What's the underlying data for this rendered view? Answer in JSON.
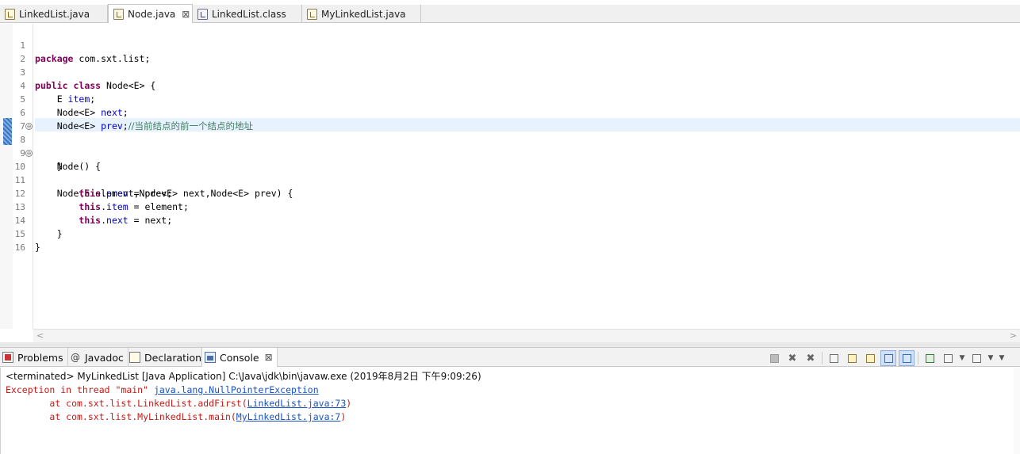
{
  "editor_tabs": [
    {
      "label": "LinkedList.java",
      "icon": "java-file-icon",
      "active": false
    },
    {
      "label": "Node.java",
      "icon": "java-file-icon",
      "active": true,
      "close": "⊠"
    },
    {
      "label": "LinkedList.class",
      "icon": "class-file-icon",
      "active": false
    },
    {
      "label": "MyLinkedList.java",
      "icon": "java-file-icon",
      "active": false
    }
  ],
  "code_lines": [
    {
      "n": "1",
      "text": "package com.sxt.list;"
    },
    {
      "n": "2",
      "text": ""
    },
    {
      "n": "3",
      "text": "public class Node<E> {"
    },
    {
      "n": "4",
      "text": "    E item;"
    },
    {
      "n": "5",
      "text": "    Node<E> next;"
    },
    {
      "n": "6",
      "text": "    Node<E> prev;//当前结点的前一个结点的地址"
    },
    {
      "n": "7",
      "text": ""
    },
    {
      "n": "8",
      "text": "    Node() {",
      "fold": "⊖",
      "current": true
    },
    {
      "n": "9",
      "text": "    }"
    },
    {
      "n": "10",
      "text": "    Node(E element,Node<E> next,Node<E> prev) {",
      "fold": "⊖"
    },
    {
      "n": "11",
      "text": "        this.prev = prev;"
    },
    {
      "n": "12",
      "text": "        this.item = element;"
    },
    {
      "n": "13",
      "text": "        this.next = next;"
    },
    {
      "n": "14",
      "text": "    }"
    },
    {
      "n": "15",
      "text": "}"
    },
    {
      "n": "16",
      "text": ""
    }
  ],
  "code_tokens": {
    "l1": {
      "kw": "package",
      "rest": " com.sxt.list;"
    },
    "l3": {
      "kw1": "public",
      "kw2": "class",
      "rest": " Node<E> {"
    },
    "l4": {
      "pre": "    E ",
      "fld": "item",
      "post": ";"
    },
    "l5": {
      "pre": "    Node<E> ",
      "fld": "next",
      "post": ";"
    },
    "l6": {
      "pre": "    Node<E> ",
      "fld": "prev",
      "post": ";",
      "cmt": "//当前结点的前一个结点的地址"
    },
    "l8": {
      "text": "    Node() {"
    },
    "l9": {
      "text": "    }"
    },
    "l10": {
      "text": "    Node(E element,Node<E> next,Node<E> prev) {"
    },
    "l11": {
      "pre": "        ",
      "kw": "this",
      "dot": ".",
      "fld": "prev",
      "post": " = prev;"
    },
    "l12": {
      "pre": "        ",
      "kw": "this",
      "dot": ".",
      "fld": "item",
      "post": " = element;"
    },
    "l13": {
      "pre": "        ",
      "kw": "this",
      "dot": ".",
      "fld": "next",
      "post": " = next;"
    },
    "l14": {
      "text": "    }"
    },
    "l15": {
      "text": "}"
    }
  },
  "view_tabs": [
    {
      "label": "Problems",
      "icon": "problems-icon"
    },
    {
      "label": "Javadoc",
      "icon": "javadoc-icon",
      "glyph": "@"
    },
    {
      "label": "Declaration",
      "icon": "declaration-icon"
    },
    {
      "label": "Console",
      "icon": "console-icon",
      "active": true,
      "close": "⊠"
    }
  ],
  "console": {
    "status": "<terminated> MyLinkedList [Java Application] C:\\Java\\jdk\\bin\\javaw.exe (2019年8月2日 下午9:09:26)",
    "line1_prefix": "Exception in thread \"main\" ",
    "line1_link": "java.lang.NullPointerException",
    "line2_prefix": "\tat com.sxt.list.LinkedList.addFirst(",
    "line2_link": "LinkedList.java:73",
    "line2_suffix": ")",
    "line3_prefix": "\tat com.sxt.list.MyLinkedList.main(",
    "line3_link": "MyLinkedList.java:7",
    "line3_suffix": ")"
  },
  "scroll": {
    "left_arrow": "<",
    "right_arrow": ">"
  },
  "colors": {
    "keyword": "#7f0055",
    "field": "#0000c0",
    "comment": "#3f7f5f",
    "error": "#c41a16",
    "link": "#1a52c2"
  }
}
